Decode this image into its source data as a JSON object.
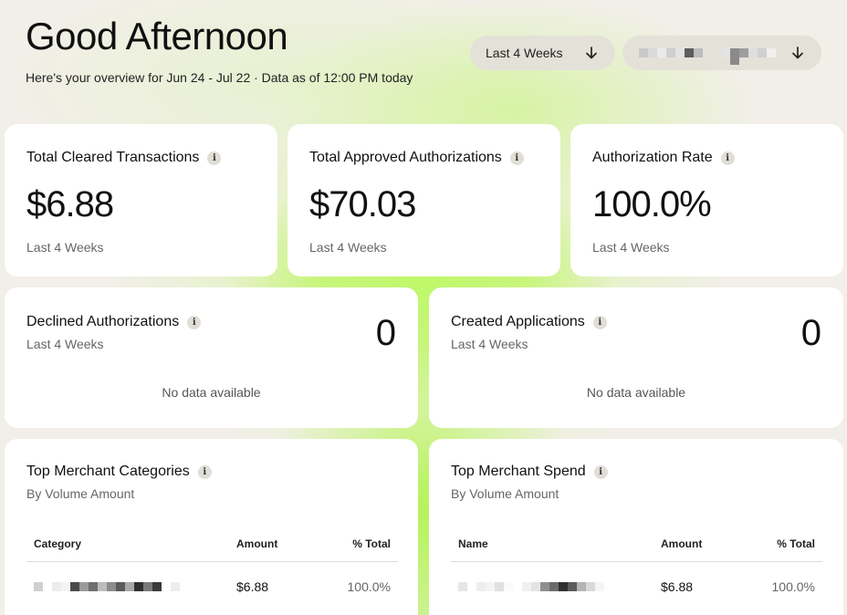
{
  "header": {
    "greeting": "Good Afternoon",
    "subtitle": "Here's your overview for Jun 24 - Jul 22 · Data as of 12:00 PM today",
    "range_dropdown": {
      "label": "Last 4 Weeks",
      "icon": "arrow-down-icon"
    },
    "account_dropdown": {
      "value_redacted": true,
      "icon": "arrow-down-icon"
    }
  },
  "metrics": [
    {
      "title": "Total Cleared Transactions",
      "value": "$6.88",
      "period": "Last 4 Weeks"
    },
    {
      "title": "Total Approved Authorizations",
      "value": "$70.03",
      "period": "Last 4 Weeks"
    },
    {
      "title": "Authorization Rate",
      "value": "100.0%",
      "period": "Last 4 Weeks"
    }
  ],
  "declined": {
    "title": "Declined Authorizations",
    "period": "Last 4 Weeks",
    "count": "0",
    "empty_text": "No data available"
  },
  "applications": {
    "title": "Created Applications",
    "period": "Last 4 Weeks",
    "count": "0",
    "empty_text": "No data available"
  },
  "top_categories": {
    "title": "Top Merchant Categories",
    "subtitle": "By Volume Amount",
    "columns": [
      "Category",
      "Amount",
      "% Total"
    ],
    "rows": [
      {
        "name_redacted": true,
        "amount": "$6.88",
        "pct": "100.0%"
      }
    ]
  },
  "top_spend": {
    "title": "Top Merchant Spend",
    "subtitle": "By Volume Amount",
    "columns": [
      "Name",
      "Amount",
      "% Total"
    ],
    "rows": [
      {
        "name_redacted": true,
        "amount": "$6.88",
        "pct": "100.0%"
      }
    ]
  },
  "colors": {
    "background": "#f1efe7",
    "accent_glow": "#bff86a",
    "card": "#ffffff",
    "pill": "#e4e2d8"
  }
}
